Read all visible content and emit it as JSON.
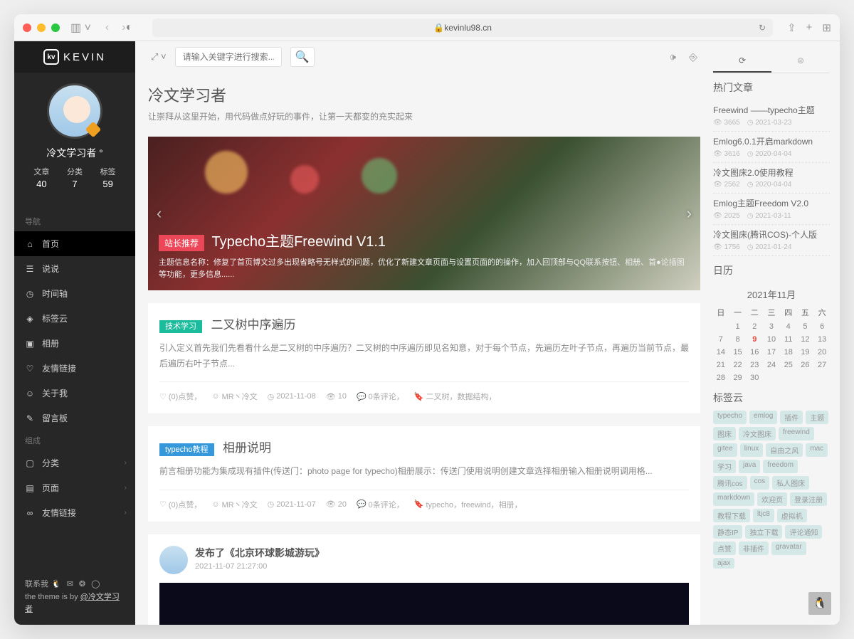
{
  "browser": {
    "url": "kevinlu98.cn"
  },
  "sidebar": {
    "logo": "KEVIN",
    "username": "冷文学习者 °",
    "stats": [
      {
        "label": "文章",
        "value": "40"
      },
      {
        "label": "分类",
        "value": "7"
      },
      {
        "label": "标签",
        "value": "59"
      }
    ],
    "nav_label": "导航",
    "nav": [
      {
        "label": "首页"
      },
      {
        "label": "说说"
      },
      {
        "label": "时间轴"
      },
      {
        "label": "标签云"
      },
      {
        "label": "相册"
      },
      {
        "label": "友情链接"
      },
      {
        "label": "关于我"
      },
      {
        "label": "留言板"
      }
    ],
    "group_label": "组成",
    "group": [
      {
        "label": "分类"
      },
      {
        "label": "页面"
      },
      {
        "label": "友情链接"
      }
    ],
    "contact": "联系我",
    "theme_prefix": "the theme is by ",
    "theme_author": "@冷文学习者"
  },
  "topbar": {
    "search_placeholder": "请输入关键字进行搜索..."
  },
  "hero": {
    "title": "冷文学习者",
    "subtitle": "让崇拜从这里开始，用代码做点好玩的事件，让第一天都变的充实起来"
  },
  "carousel": {
    "badge": "站长推荐",
    "title": "Typecho主题Freewind V1.1",
    "desc": "主题信息名称：修复了首页博文过多出现省略号无样式的问题，优化了新建文章页面与设置页面的的操作，加入回顶部与QQ联系按钮、相册、首●论插图等功能，更多信息......"
  },
  "posts": [
    {
      "tag": "技术学习",
      "tag_class": "tag-green",
      "title": "二叉树中序遍历",
      "excerpt": "引入定义首先我们先看看什么是二叉树的中序遍历？二叉树的中序遍历即见名知意，对于每个节点，先遍历左叶子节点，再遍历当前节点，最后遍历右叶子节点...",
      "likes": "(0)点赞，",
      "author": "MR丶冷文",
      "date": "2021-11-08",
      "views": "10",
      "comments": "0条评论，",
      "tags": "二叉树，数据结构，"
    },
    {
      "tag": "typecho教程",
      "tag_class": "tag-blue",
      "title": "相册说明",
      "excerpt": "前言相册功能为集成现有插件(传送门：photo page for typecho)相册展示：传送门使用说明创建文章选择相册输入相册说明调用格...",
      "likes": "(0)点赞，",
      "author": "MR丶冷文",
      "date": "2021-11-07",
      "views": "20",
      "comments": "0条评论，",
      "tags": "typecho，freewind，相册，"
    }
  ],
  "shuoshuo": {
    "title": "发布了《北京环球影城游玩》",
    "time": "2021-11-07 21:27:00"
  },
  "aside": {
    "hot_title": "热门文章",
    "hot": [
      {
        "title": "Freewind ——typecho主题",
        "views": "3665",
        "date": "2021-03-23"
      },
      {
        "title": "Emlog6.0.1开启markdown",
        "views": "3616",
        "date": "2020-04-04"
      },
      {
        "title": "冷文图床2.0使用教程",
        "views": "2562",
        "date": "2020-04-04"
      },
      {
        "title": "Emlog主题Freedom V2.0",
        "views": "2025",
        "date": "2021-03-11"
      },
      {
        "title": "冷文图床(腾讯COS)-个人版",
        "views": "1756",
        "date": "2021-01-24"
      }
    ],
    "calendar_title": "日历",
    "calendar_month": "2021年11月",
    "calendar_headers": [
      "日",
      "一",
      "二",
      "三",
      "四",
      "五",
      "六"
    ],
    "calendar_days": [
      "",
      "1",
      "2",
      "3",
      "4",
      "5",
      "6",
      "7",
      "8",
      "9",
      "10",
      "11",
      "12",
      "13",
      "14",
      "15",
      "16",
      "17",
      "18",
      "19",
      "20",
      "21",
      "22",
      "23",
      "24",
      "25",
      "26",
      "27",
      "28",
      "29",
      "30"
    ],
    "calendar_today": "9",
    "tags_title": "标签云",
    "tags": [
      "typecho",
      "emlog",
      "插件",
      "主题",
      "图床",
      "冷文图床",
      "freewind",
      "gitee",
      "linux",
      "自由之风",
      "mac",
      "学习",
      "java",
      "freedom",
      "腾讯cos",
      "cos",
      "私人图床",
      "markdown",
      "欢迎页",
      "登录注册",
      "教程下载",
      "ltjc8",
      "虚拟机",
      "静态IP",
      "独立下载",
      "评论通知",
      "点赞",
      "非插件",
      "gravatar",
      "ajax"
    ]
  }
}
